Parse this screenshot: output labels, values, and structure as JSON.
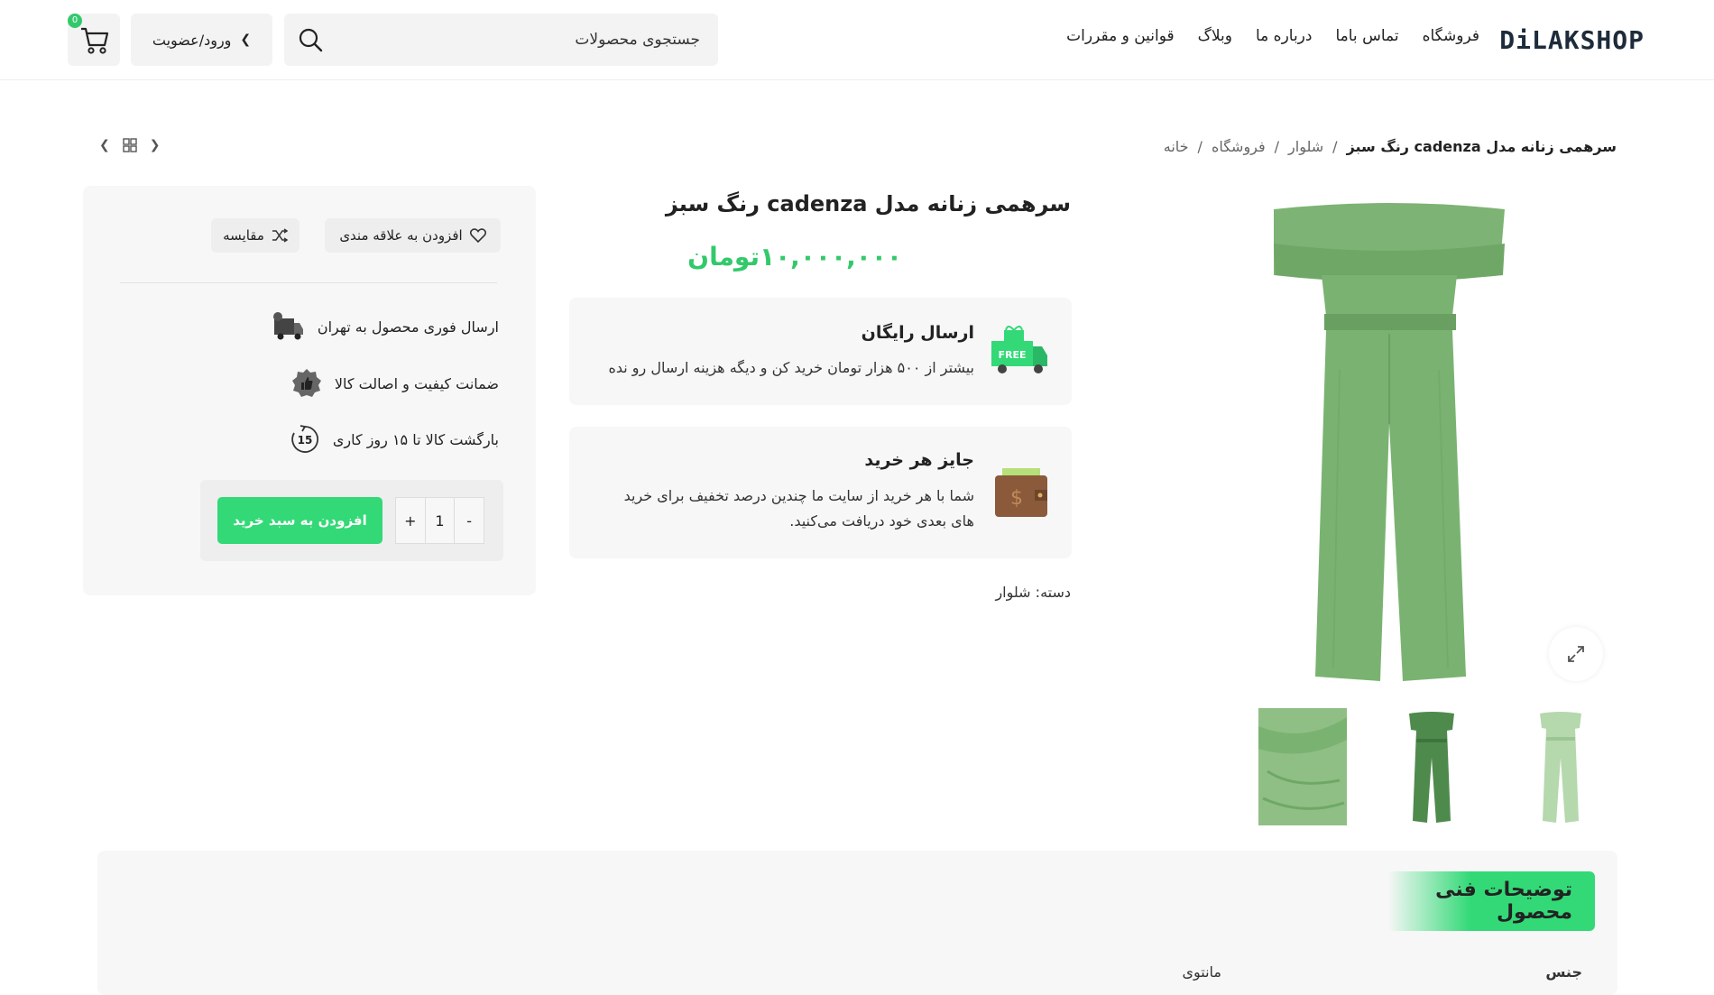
{
  "header": {
    "logo": "DiLAKSHOP",
    "nav": [
      "فروشگاه",
      "تماس باما",
      "درباره ما",
      "وبلاگ",
      "قوانین و مقررات"
    ],
    "search_placeholder": "جستجوی محصولات",
    "login_label": "ورود/عضویت",
    "cart_count": "0"
  },
  "breadcrumb": {
    "items": [
      "خانه",
      "فروشگاه",
      "شلوار"
    ],
    "current": "سرهمی زنانه مدل cadenza رنگ سبز",
    "separator": "/"
  },
  "product": {
    "title": "سرهمی زنانه مدل cadenza رنگ سبز",
    "price": "۱۰,۰۰۰,۰۰۰تومان",
    "category_label": "دسته:",
    "category_value": "شلوار"
  },
  "info_boxes": [
    {
      "title": "ارسال رایگان",
      "desc": "بیشتر از ۵۰۰ هزار تومان خرید کن و دیگه هزینه ارسال رو نده",
      "icon": "free-shipping-truck-icon"
    },
    {
      "title": "جایز هر خرید",
      "desc_line1": "شما با هر خرید از سایت ما چندین درصد تخفیف برای خرید",
      "desc_line2": "های بعدی خود دریافت می‌کنید.",
      "icon": "wallet-icon"
    }
  ],
  "panel": {
    "wishlist_label": "افزودن به علاقه مندی",
    "compare_label": "مقایسه",
    "features": [
      {
        "label": "ارسال فوری محصول به تهران",
        "icon": "delivery-truck-icon"
      },
      {
        "label": "ضمانت کیفیت و اصالت کالا",
        "icon": "quality-badge-icon"
      },
      {
        "label": "بارگشت کالا تا ۱۵ روز کاری",
        "icon": "return-15-icon"
      }
    ],
    "qty_minus": "-",
    "qty_value": "1",
    "qty_plus": "+",
    "add_to_cart_label": "افزودن به سبد خرید"
  },
  "specs": {
    "tab_label": "توضیحات فنی محصول",
    "row_label": "جنس",
    "row_value": "مانتوی"
  },
  "colors": {
    "accent": "#33d977",
    "price": "#33c96b",
    "product_green": "#7ab371"
  }
}
